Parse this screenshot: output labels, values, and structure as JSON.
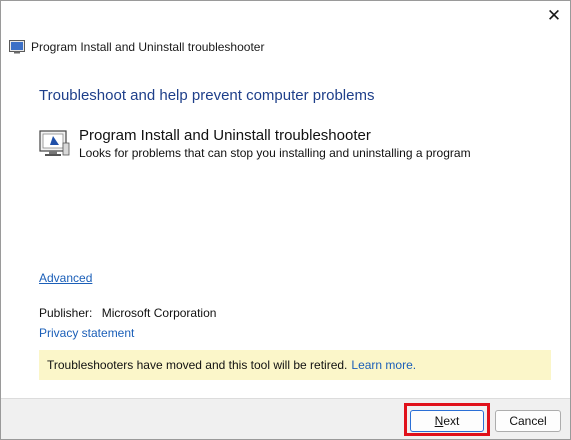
{
  "window": {
    "title": "Program Install and Uninstall troubleshooter",
    "close_glyph": "✕"
  },
  "main": {
    "heading": "Troubleshoot and help prevent computer problems",
    "item": {
      "title": "Program Install and Uninstall troubleshooter",
      "description": "Looks for problems that can stop you installing and uninstalling a program",
      "icon": "troubleshooter-monitor-icon"
    },
    "advanced_link": "Advanced",
    "publisher_label": "Publisher:",
    "publisher_value": "Microsoft Corporation",
    "privacy_link": "Privacy statement",
    "notice": {
      "text": "Troubleshooters have moved and this tool will be retired.",
      "link": "Learn more."
    }
  },
  "footer": {
    "next_mnemonic": "N",
    "next_rest": "ext",
    "cancel_label": "Cancel"
  },
  "colors": {
    "heading": "#1e3f8a",
    "link": "#1b5fb8",
    "notice_bg": "#fbf6c9",
    "highlight": "#e0101a"
  }
}
